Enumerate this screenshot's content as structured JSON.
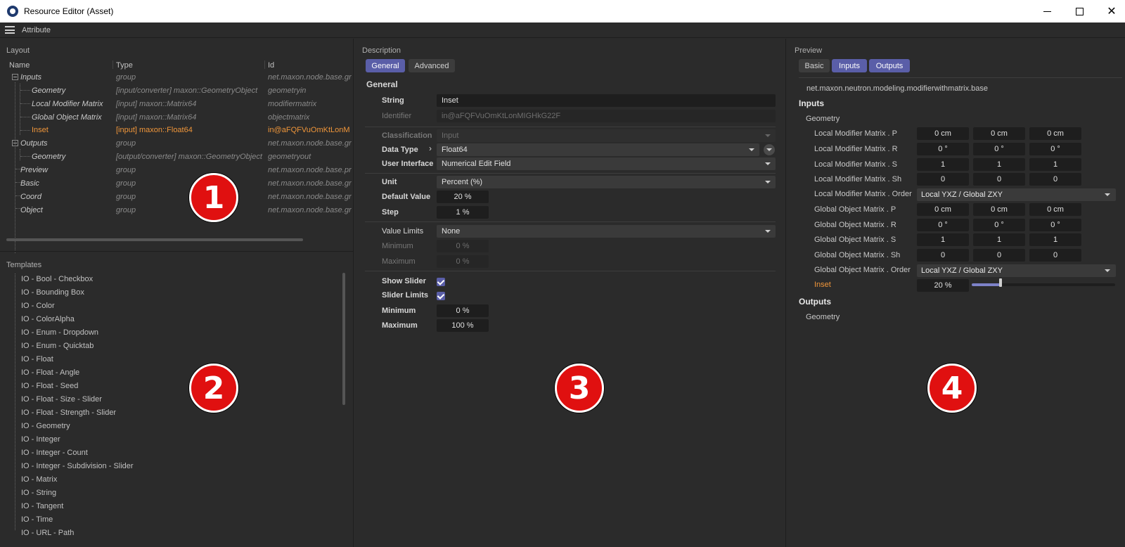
{
  "window": {
    "title": "Resource Editor (Asset)"
  },
  "menubar": {
    "attribute": "Attribute"
  },
  "layout": {
    "section": "Layout",
    "columns": [
      "Name",
      "Type",
      "Id"
    ],
    "rows": [
      {
        "name": "Inputs",
        "type": "group",
        "id": "net.maxon.node.base.gr"
      },
      {
        "name": "Geometry",
        "type": "[input/converter] maxon::GeometryObject",
        "id": "geometryin"
      },
      {
        "name": "Local Modifier Matrix",
        "type": "[input] maxon::Matrix64",
        "id": "modifiermatrix"
      },
      {
        "name": "Global Object Matrix",
        "type": "[input] maxon::Matrix64",
        "id": "objectmatrix"
      },
      {
        "name": "Inset",
        "type": "[input] maxon::Float64",
        "id": "in@aFQFVuOmKtLonM"
      },
      {
        "name": "Outputs",
        "type": "group",
        "id": "net.maxon.node.base.gr"
      },
      {
        "name": "Geometry",
        "type": "[output/converter] maxon::GeometryObject",
        "id": "geometryout"
      },
      {
        "name": "Preview",
        "type": "group",
        "id": "net.maxon.node.base.pr"
      },
      {
        "name": "Basic",
        "type": "group",
        "id": "net.maxon.node.base.gr"
      },
      {
        "name": "Coord",
        "type": "group",
        "id": "net.maxon.node.base.gr"
      },
      {
        "name": "Object",
        "type": "group",
        "id": "net.maxon.node.base.gr"
      }
    ]
  },
  "templates": {
    "section": "Templates",
    "items": [
      "IO - Bool - Checkbox",
      "IO - Bounding Box",
      "IO - Color",
      "IO - ColorAlpha",
      "IO - Enum - Dropdown",
      "IO - Enum - Quicktab",
      "IO - Float",
      "IO - Float - Angle",
      "IO - Float - Seed",
      "IO - Float - Size - Slider",
      "IO - Float - Strength - Slider",
      "IO - Geometry",
      "IO - Integer",
      "IO - Integer - Count",
      "IO - Integer - Subdivision - Slider",
      "IO - Matrix",
      "IO - String",
      "IO - Tangent",
      "IO - Time",
      "IO - URL - Path"
    ]
  },
  "markers": [
    "1",
    "2",
    "3",
    "4"
  ],
  "description": {
    "section": "Description",
    "tabs": [
      "General",
      "Advanced"
    ],
    "group": "General",
    "string_label": "String",
    "string_value": "Inset",
    "identifier_label": "Identifier",
    "identifier_value": "in@aFQFVuOmKtLonMIGHkG22F",
    "classification_label": "Classification",
    "classification_value": "Input",
    "datatype_label": "Data Type",
    "datatype_value": "Float64",
    "ui_label": "User Interface",
    "ui_value": "Numerical Edit Field",
    "unit_label": "Unit",
    "unit_value": "Percent (%)",
    "default_label": "Default Value",
    "default_value": "20 %",
    "step_label": "Step",
    "step_value": "1 %",
    "limits_label": "Value Limits",
    "limits_value": "None",
    "min_label": "Minimum",
    "min_value": "0 %",
    "max_label": "Maximum",
    "max_value": "0 %",
    "show_slider_label": "Show Slider",
    "show_slider": true,
    "slider_limits_label": "Slider Limits",
    "slider_limits": true,
    "slider_min_label": "Minimum",
    "slider_min_value": "0 %",
    "slider_max_label": "Maximum",
    "slider_max_value": "100 %"
  },
  "preview": {
    "section": "Preview",
    "tabs": [
      "Basic",
      "Inputs",
      "Outputs"
    ],
    "asset_id": "net.maxon.neutron.modeling.modifierwithmatrix.base",
    "inputs_head": "Inputs",
    "geometry_label": "Geometry",
    "rows": [
      {
        "label": "Local Modifier Matrix . P",
        "values": [
          "0 cm",
          "0 cm",
          "0 cm"
        ]
      },
      {
        "label": "Local Modifier Matrix . R",
        "values": [
          "0 °",
          "0 °",
          "0 °"
        ]
      },
      {
        "label": "Local Modifier Matrix . S",
        "values": [
          "1",
          "1",
          "1"
        ]
      },
      {
        "label": "Local Modifier Matrix . Sh",
        "values": [
          "0",
          "0",
          "0"
        ]
      },
      {
        "label": "Local Modifier Matrix . Order",
        "dropdown": "Local YXZ / Global ZXY"
      },
      {
        "label": "Global Object Matrix . P",
        "values": [
          "0 cm",
          "0 cm",
          "0 cm"
        ]
      },
      {
        "label": "Global Object Matrix . R",
        "values": [
          "0 °",
          "0 °",
          "0 °"
        ]
      },
      {
        "label": "Global Object Matrix . S",
        "values": [
          "1",
          "1",
          "1"
        ]
      },
      {
        "label": "Global Object Matrix . Sh",
        "values": [
          "0",
          "0",
          "0"
        ]
      },
      {
        "label": "Global Object Matrix . Order",
        "dropdown": "Local YXZ / Global ZXY"
      }
    ],
    "inset_label": "Inset",
    "inset_value": "20 %",
    "inset_fraction": 0.2,
    "outputs_head": "Outputs",
    "out_geometry_label": "Geometry"
  },
  "colors": {
    "accent": "#5a5ea8",
    "selected": "#f0963a",
    "marker": "#e01010"
  }
}
